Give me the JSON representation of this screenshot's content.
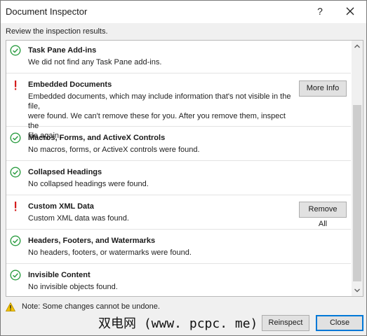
{
  "window": {
    "title": "Document Inspector",
    "help_glyph": "?",
    "close_icon": "close-icon"
  },
  "subtitle": "Review the inspection results.",
  "results": [
    {
      "status": "ok",
      "icon": "check-circle-icon",
      "title": "Task Pane Add-ins",
      "description": "We did not find any Task Pane add-ins."
    },
    {
      "status": "warning",
      "icon": "exclamation-icon",
      "title": "Embedded Documents",
      "description_lines": [
        "Embedded documents, which may include information that's not visible in the file,",
        "were found. We can't remove these for you. After you remove them, inspect the",
        "file again."
      ],
      "button": "More Info"
    },
    {
      "status": "ok",
      "icon": "check-circle-icon",
      "title": "Macros, Forms, and ActiveX Controls",
      "description": "No macros, forms, or ActiveX controls were found."
    },
    {
      "status": "ok",
      "icon": "check-circle-icon",
      "title": "Collapsed Headings",
      "description": "No collapsed headings were found."
    },
    {
      "status": "warning",
      "icon": "exclamation-icon",
      "title": "Custom XML Data",
      "description": "Custom XML data was found.",
      "button": "Remove All"
    },
    {
      "status": "ok",
      "icon": "check-circle-icon",
      "title": "Headers, Footers, and Watermarks",
      "description": "No headers, footers, or watermarks were found."
    },
    {
      "status": "ok",
      "icon": "check-circle-icon",
      "title": "Invisible Content",
      "description": "No invisible objects found."
    }
  ],
  "note": {
    "icon": "warning-triangle-icon",
    "text": "Note: Some changes cannot be undone."
  },
  "watermark": "双电网 (www. pcpc. me)",
  "footer": {
    "reinspect": "Reinspect",
    "close": "Close"
  },
  "colors": {
    "ok_green": "#2e9e44",
    "warning_red": "#d41c1c",
    "warning_yellow": "#f2c200",
    "accent_blue": "#0078d7"
  }
}
